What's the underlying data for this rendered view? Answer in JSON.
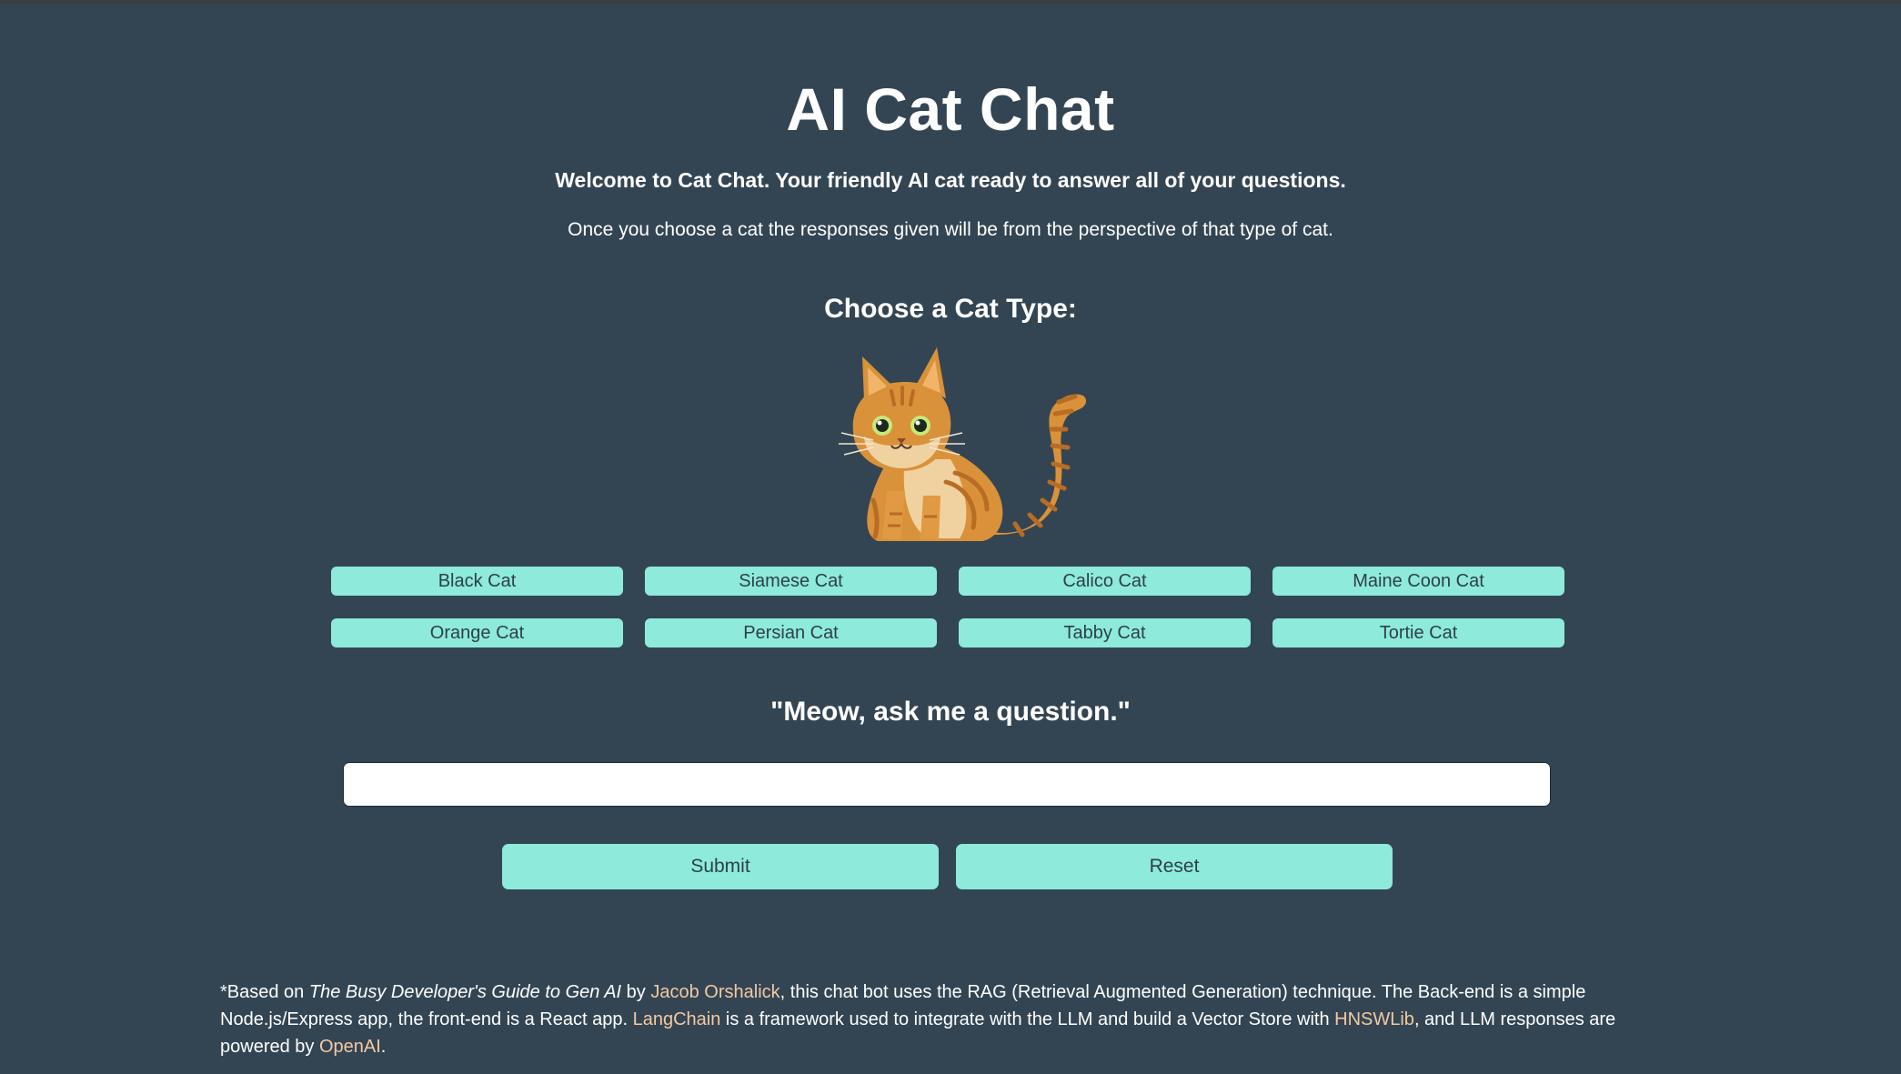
{
  "header": {
    "title": "AI Cat Chat",
    "welcome": "Welcome to Cat Chat. Your friendly AI cat ready to answer all of your questions.",
    "perspective": "Once you choose a cat the responses given will be from the perspective of that type of cat."
  },
  "cat_selector": {
    "heading": "Choose a Cat Type:",
    "illustration_icon": "orange-tabby-cat-illustration",
    "cats": [
      {
        "label": "Black Cat"
      },
      {
        "label": "Siamese Cat"
      },
      {
        "label": "Calico Cat"
      },
      {
        "label": "Maine Coon Cat"
      },
      {
        "label": "Orange Cat"
      },
      {
        "label": "Persian Cat"
      },
      {
        "label": "Tabby Cat"
      },
      {
        "label": "Tortie Cat"
      }
    ]
  },
  "chat": {
    "prompt": "\"Meow, ask me a question.\"",
    "input_value": "",
    "input_placeholder": "",
    "submit_label": "Submit",
    "reset_label": "Reset"
  },
  "footer": {
    "prefix": "*Based on ",
    "book_title": "The Busy Developer's Guide to Gen AI",
    "by": " by ",
    "author_link": "Jacob Orshalick",
    "middle": ", this chat bot uses the RAG (Retrieval Augmented Generation) technique. The Back-end is a simple Node.js/Express app, the front-end is a React app. ",
    "langchain_link": "LangChain",
    "middle2": " is a framework used to integrate with the LLM and build a Vector Store with ",
    "hnswlib_link": "HNSWLib",
    "middle3": ", and LLM responses are powered by ",
    "openai_link": "OpenAI",
    "suffix": "."
  },
  "colors": {
    "background": "#334553",
    "button": "#8eeadb",
    "button_text": "#2e3f4b",
    "link": "#f3c9a2",
    "cat_fur": "#d9923a",
    "cat_stripe": "#b86c24",
    "cat_belly": "#f0d2a0"
  }
}
